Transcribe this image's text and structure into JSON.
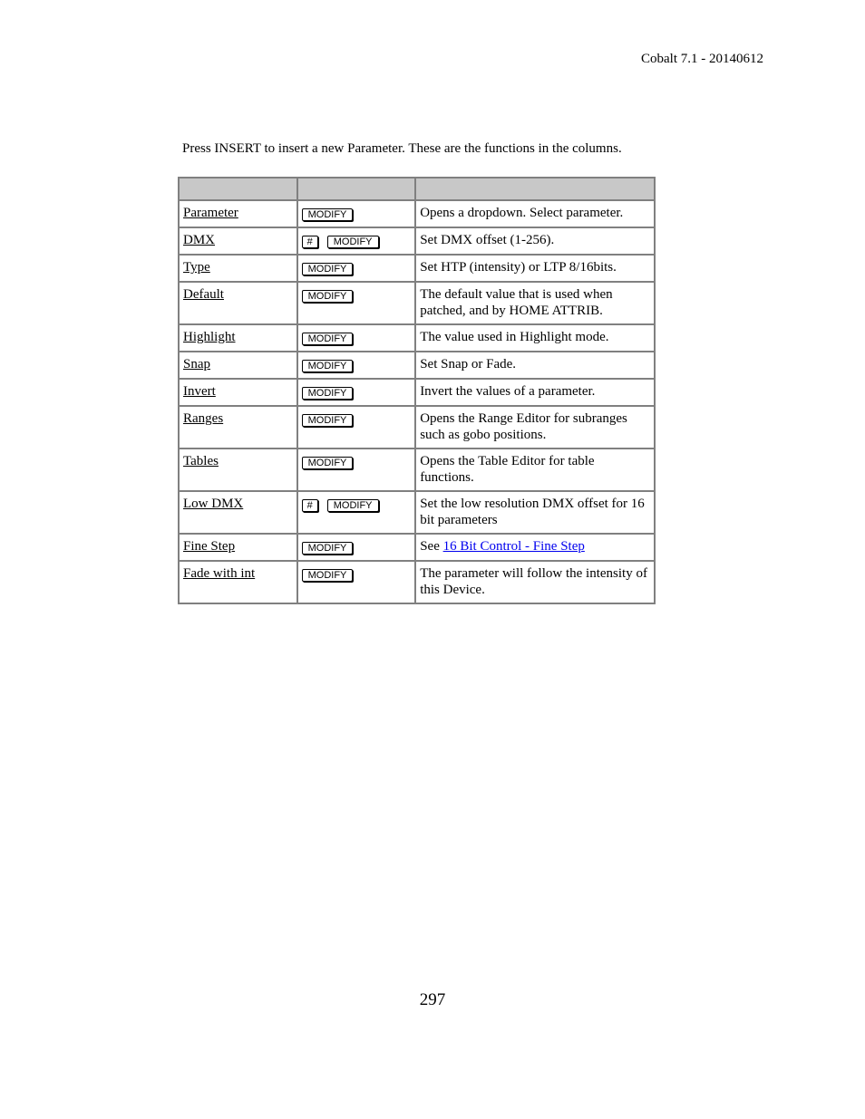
{
  "header": {
    "title": "Cobalt 7.1 - 20140612"
  },
  "intro": "Press INSERT to insert a new Parameter. These are the functions in the columns.",
  "table": {
    "headers": [
      "",
      "",
      ""
    ],
    "rows": [
      {
        "name": "Parameter",
        "keys": [
          "MODIFY"
        ],
        "desc": "Opens a dropdown. Select parameter."
      },
      {
        "name": "DMX",
        "keys": [
          "#",
          "MODIFY"
        ],
        "desc": "Set DMX offset (1-256)."
      },
      {
        "name": "Type",
        "keys": [
          "MODIFY"
        ],
        "desc": "Set HTP (intensity) or LTP 8/16bits."
      },
      {
        "name": "Default",
        "keys": [
          "MODIFY"
        ],
        "desc": "The default value that is used when patched, and by HOME ATTRIB."
      },
      {
        "name": "Highlight",
        "keys": [
          "MODIFY"
        ],
        "desc": "The value used in Highlight mode."
      },
      {
        "name": "Snap",
        "keys": [
          "MODIFY"
        ],
        "desc": "Set Snap or Fade."
      },
      {
        "name": "Invert",
        "keys": [
          "MODIFY"
        ],
        "desc": "Invert the values of a parameter."
      },
      {
        "name": "Ranges",
        "keys": [
          "MODIFY"
        ],
        "desc": "Opens the Range Editor for subranges such as gobo positions."
      },
      {
        "name": "Tables",
        "keys": [
          "MODIFY"
        ],
        "desc": "Opens the Table Editor for table functions."
      },
      {
        "name": "Low DMX",
        "keys": [
          "#",
          "MODIFY"
        ],
        "desc": "Set the low resolution DMX offset for 16 bit parameters"
      },
      {
        "name": "Fine Step",
        "keys": [
          "MODIFY"
        ],
        "desc_prefix": "See ",
        "desc_link": "16 Bit Control - Fine Step"
      },
      {
        "name": "Fade with int",
        "keys": [
          "MODIFY"
        ],
        "desc": "The parameter will follow the intensity of this Device."
      }
    ]
  },
  "footer": {
    "page_number": "297"
  },
  "colors": {
    "link": "#0000ee",
    "header_bg": "#c8c8c8",
    "border": "#808080"
  }
}
